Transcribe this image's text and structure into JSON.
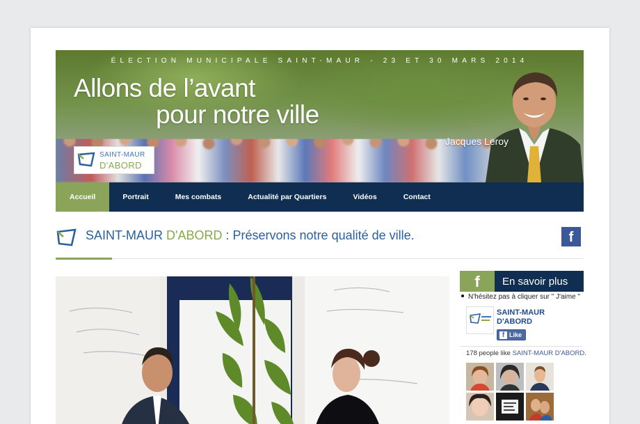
{
  "banner": {
    "tagline": "ÉLECTION MUNICIPALE SAINT-MAUR - 23 ET 30 MARS 2014",
    "slogan_line1": "Allons de l’avant",
    "slogan_line2": "pour notre ville",
    "candidate_name": "Jacques Leroy",
    "logo": {
      "line1": "SAINT-MAUR",
      "line2": "D'ABORD"
    }
  },
  "nav": {
    "items": [
      {
        "label": "Accueil",
        "active": true
      },
      {
        "label": "Portrait",
        "active": false
      },
      {
        "label": "Mes combats",
        "active": false
      },
      {
        "label": "Actualité par Quartiers",
        "active": false
      },
      {
        "label": "Vidéos",
        "active": false
      },
      {
        "label": "Contact",
        "active": false
      }
    ]
  },
  "headline": {
    "brand_part1": "SAINT-MAUR",
    "brand_part2": "D'ABORD",
    "text": ": Préservons notre qualité de ville."
  },
  "facebook_icon_letter": "f",
  "sidebar": {
    "header_title": "En savoir plus",
    "hint": "N'hésitez pas à cliquer sur \" J'aime \"",
    "fb_page": {
      "name": "SAINT-MAUR D'ABORD",
      "like_label": "Like"
    },
    "likes_count_text": "178 people like",
    "likes_page_link": "SAINT-MAUR D'ABORD",
    "likes_suffix": "."
  },
  "colors": {
    "navy": "#0f2e52",
    "green": "#8aa55a",
    "brand_blue": "#2a5f9e",
    "facebook_blue": "#3b5998"
  }
}
